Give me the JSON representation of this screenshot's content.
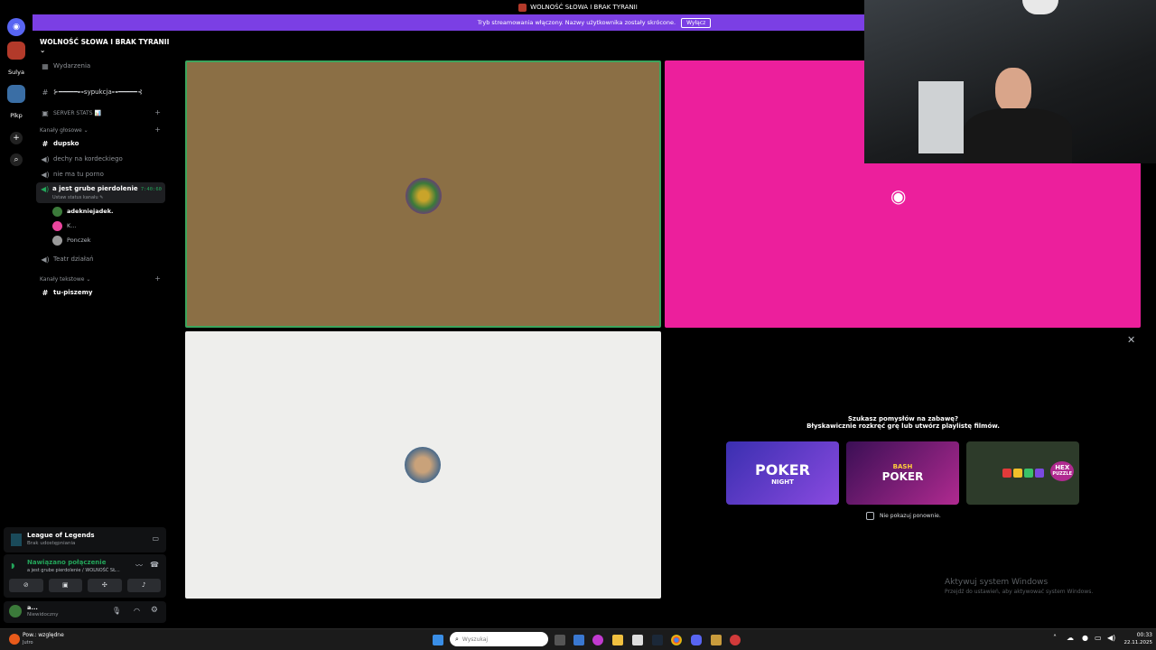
{
  "window": {
    "title": "WOLNOŚĆ SŁOWA I BRAK TYRANII"
  },
  "banner": {
    "text": "Tryb streamowania włączony. Nazwy użytkownika zostały skrócone.",
    "button": "Wyłącz"
  },
  "rail": {
    "items": [
      {
        "label": "Sulya"
      },
      {
        "label": "Plkp"
      }
    ]
  },
  "sidebar": {
    "server_name": "WOLNOŚĆ SŁOWA I BRAK TYRANII",
    "events": "Wydarzenia",
    "channel_top": "⊱━━━━━⊷sypukcja⊶━━━━━⊰",
    "server_stats": "SERVER STATS 📊",
    "voice_category": "Kanały głosowe",
    "voice_channels": [
      {
        "name": "dupsko",
        "icon": "hash"
      },
      {
        "name": "dechy na kordeckiego",
        "icon": "speaker"
      },
      {
        "name": "nie ma tu porno",
        "icon": "speaker"
      },
      {
        "name": "a jest grube pierdolenie",
        "icon": "speaker",
        "timer": "7:40:60",
        "status": "Ustaw status kanału"
      }
    ],
    "members": [
      {
        "name": "adekniejadek.",
        "color": "#3b7a3a"
      },
      {
        "name": "K...",
        "color": "#eb459e"
      },
      {
        "name": "Ponczek",
        "color": "#9a9a9a"
      }
    ],
    "stage": "Teatr działań",
    "text_category": "Kanały tekstowe",
    "text_channels": [
      {
        "name": "tu-piszemy"
      }
    ]
  },
  "activity": {
    "game": "League of Legends",
    "sub": "Brak udostępniania"
  },
  "connection": {
    "status": "Nawiązano połączenie",
    "detail": "a jest grube pierdolenie / WOLNOŚĆ SŁ..."
  },
  "user": {
    "name": "a...",
    "status": "Niewidoczny"
  },
  "promo": {
    "line1": "Szukasz pomysłów na zabawę?",
    "line2": "Błyskawicznie rozkręć grę lub utwórz playlistę filmów.",
    "cards": [
      {
        "title": "POKER",
        "subtitle": "NIGHT",
        "bg": "#5b3fd1"
      },
      {
        "title": "POKER",
        "subtitle": "BASH",
        "bg": "#6a1f8a"
      },
      {
        "title": "HEX",
        "subtitle": "PUZZLE",
        "bg": "#2d3b2a"
      }
    ],
    "checkbox": "Nie pokazuj ponownie."
  },
  "watermark": {
    "line1": "Aktywuj system Windows",
    "line2": "Przejdź do ustawień, aby aktywować system Windows."
  },
  "taskbar": {
    "weather_top": "Pow.: względne",
    "weather_bottom": "Jutro",
    "search_placeholder": "Wyszukaj",
    "time": "00:33",
    "date": "22.11.2025"
  },
  "colors": {
    "tile1": "#8b6f45",
    "tile2": "#ec1f9c",
    "tile3": "#eeeeec",
    "accent": "#7b3fe4"
  }
}
